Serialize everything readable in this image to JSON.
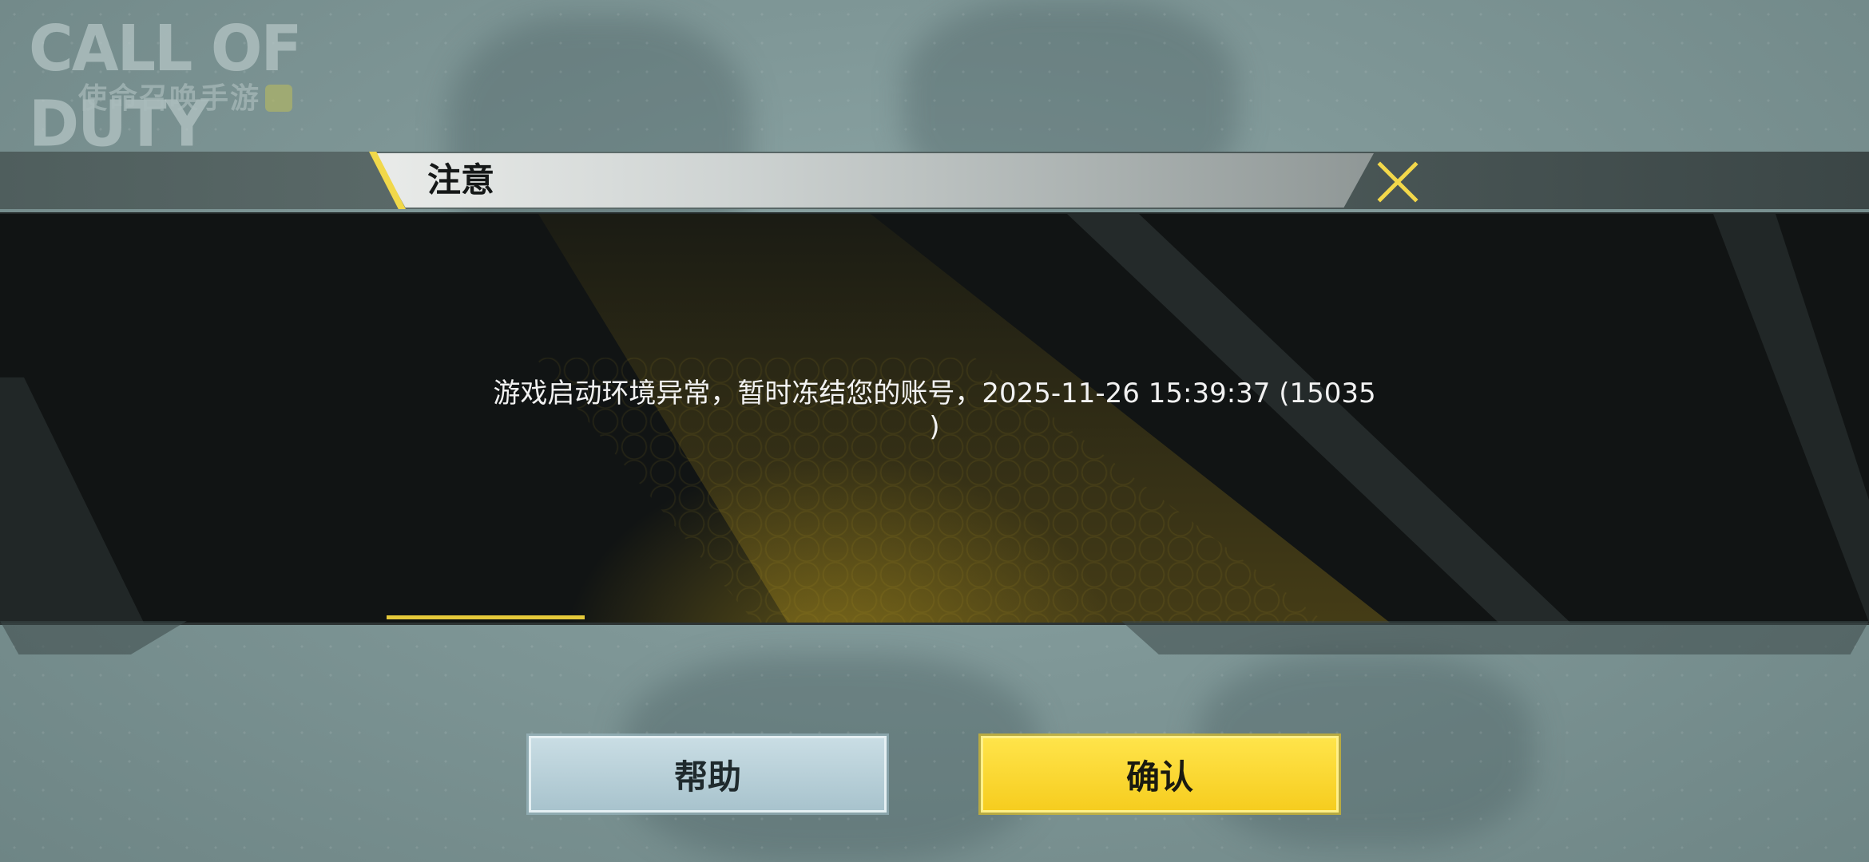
{
  "logo": {
    "main_text": "CALL OF DUTY",
    "sub_text": "使命召唤手游"
  },
  "dialog": {
    "title": "注意",
    "message_line1": "游戏启动环境异常，暂时冻结您的账号，2025-11-26 15:39:37 (15035",
    "message_line2": ")"
  },
  "buttons": {
    "help_label": "帮助",
    "confirm_label": "确认"
  },
  "colors": {
    "accent_yellow": "#f6cd1f",
    "help_blue": "#a8c3cd",
    "panel_dark": "#111414"
  },
  "icons": {
    "close": "close-x-icon"
  }
}
